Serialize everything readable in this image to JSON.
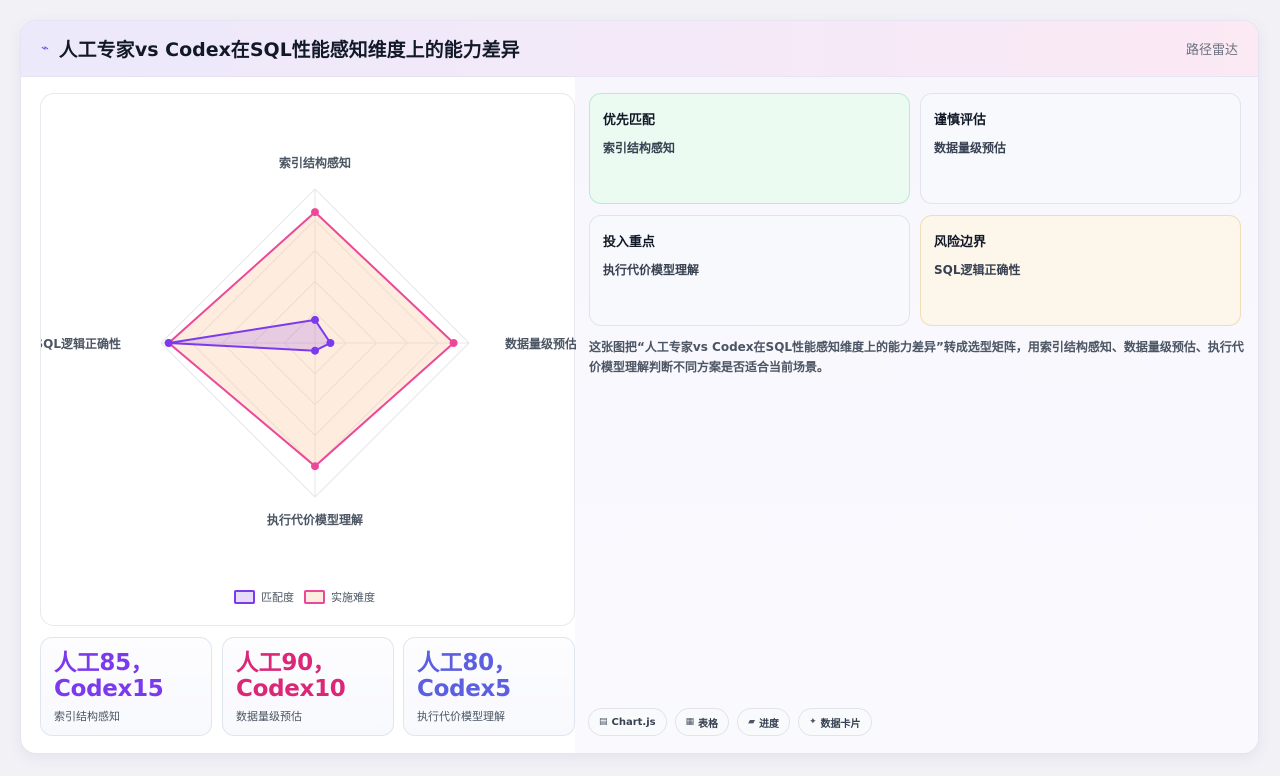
{
  "header": {
    "title": "人工专家vs Codex在SQL性能感知维度上的能力差异",
    "mode": "路径雷达"
  },
  "chart_data": {
    "type": "radar",
    "axes": [
      "索引结构感知",
      "数据量级预估",
      "执行代价模型理解",
      "SQL逻辑正确性"
    ],
    "series": [
      {
        "name": "匹配度",
        "values": [
          15,
          10,
          5,
          95
        ],
        "color": "#7c3aed"
      },
      {
        "name": "实施难度",
        "values": [
          85,
          90,
          80,
          95
        ],
        "color": "#ec4899"
      }
    ],
    "rmax": 100,
    "grid_levels": 5,
    "legend_position": "bottom"
  },
  "stats": [
    {
      "value": "人工85，Codex15",
      "label": "索引结构感知",
      "color": "#7c3aed"
    },
    {
      "value": "人工90，Codex10",
      "label": "数据量级预估",
      "color": "#db2777"
    },
    {
      "value": "人工80，Codex5",
      "label": "执行代价模型理解",
      "color": "#5b5fe0"
    }
  ],
  "tiles": [
    {
      "title": "优先匹配",
      "value": "索引结构感知"
    },
    {
      "title": "谨慎评估",
      "value": "数据量级预估"
    },
    {
      "title": "投入重点",
      "value": "执行代价模型理解"
    },
    {
      "title": "风险边界",
      "value": "SQL逻辑正确性"
    }
  ],
  "description": "这张图把“人工专家vs Codex在SQL性能感知维度上的能力差异”转成选型矩阵，用索引结构感知、数据量级预估、执行代价模型理解判断不同方案是否适合当前场景。",
  "chips": [
    {
      "icon": "chart-icon",
      "glyph": "▤",
      "label": "Chart.js"
    },
    {
      "icon": "table-icon",
      "glyph": "▦",
      "label": "表格"
    },
    {
      "icon": "progress-icon",
      "glyph": "▰",
      "label": "进度"
    },
    {
      "icon": "card-icon",
      "glyph": "✦",
      "label": "数据卡片"
    }
  ]
}
